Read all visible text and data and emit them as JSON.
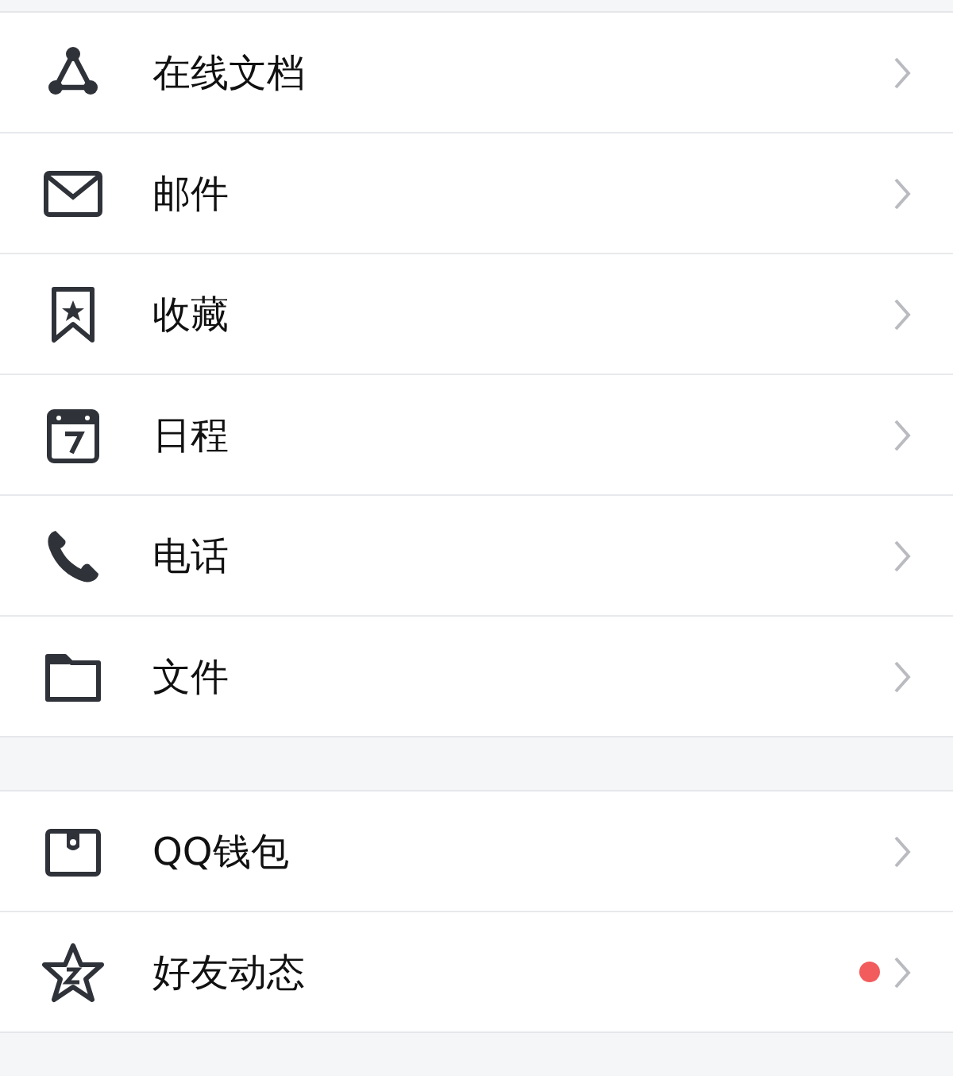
{
  "groups": [
    {
      "items": [
        {
          "label": "在线文档",
          "dot": false
        },
        {
          "label": "邮件",
          "dot": false
        },
        {
          "label": "收藏",
          "dot": false
        },
        {
          "label": "日程",
          "dot": false
        },
        {
          "label": "电话",
          "dot": false
        },
        {
          "label": "文件",
          "dot": false
        }
      ]
    },
    {
      "items": [
        {
          "label": "QQ钱包",
          "dot": false
        },
        {
          "label": "好友动态",
          "dot": true
        }
      ]
    }
  ]
}
